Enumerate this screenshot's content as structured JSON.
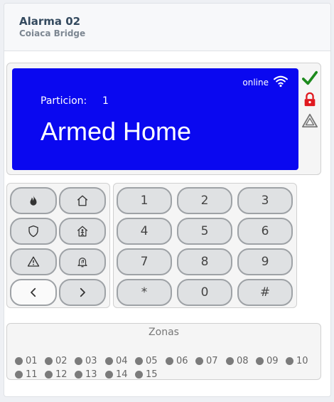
{
  "header": {
    "title": "Alarma 02",
    "subtitle": "Coiaca Bridge"
  },
  "display": {
    "connection": "online",
    "partition_label": "Particion:",
    "partition_value": "1",
    "state": "Armed Home",
    "background_color": "#0a08f0"
  },
  "status_icons": [
    "check-icon",
    "lock-icon",
    "warning-triangle-icon"
  ],
  "function_keys": [
    "fire-icon",
    "home-icon",
    "police-badge-icon",
    "medical-person-icon",
    "warning-icon",
    "bell-icon",
    "chevron-left-icon",
    "chevron-right-icon"
  ],
  "keypad": {
    "k1": "1",
    "k2": "2",
    "k3": "3",
    "k4": "4",
    "k5": "5",
    "k6": "6",
    "k7": "7",
    "k8": "8",
    "k9": "9",
    "kstar": "*",
    "k0": "0",
    "khash": "#"
  },
  "zones": {
    "title": "Zonas",
    "items": [
      "01",
      "02",
      "03",
      "04",
      "05",
      "06",
      "07",
      "08",
      "09",
      "10",
      "11",
      "12",
      "13",
      "14",
      "15"
    ]
  }
}
